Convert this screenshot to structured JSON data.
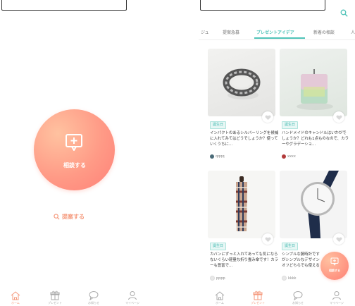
{
  "left": {
    "consult_button": {
      "label": "相談する",
      "icon": "chat-plus-icon"
    },
    "proposal_link": {
      "label": "提案する",
      "icon": "search-icon"
    }
  },
  "right": {
    "tabs": [
      "ジュ",
      "提案急募",
      "プレゼントアイデア",
      "新着の相談",
      "人"
    ],
    "active_tab_index": 2,
    "cards": [
      {
        "tag": "誕生日",
        "desc": "インパクトのあるシルバーリングを候補に入れてみてはどうでしょうか？使っていくうちに…",
        "user": "qqqq",
        "image": "silver-ring"
      },
      {
        "tag": "誕生日",
        "desc": "ハンドメイドのキャンドルはいかがでしょうか？どれも1点ものなので、カラーやグラデーショ…",
        "user": "xxxx",
        "image": "candle"
      },
      {
        "tag": "誕生日",
        "desc": "カバンにずっと入れてあっても気にならないぐらい軽量な折り畳み傘です！カラーも豊富で…",
        "user": "pppp",
        "image": "umbrella"
      },
      {
        "tag": "誕生日",
        "desc": "シンプルな腕時計ですがシンプルなデザインオフどちらでも使えるのではないでしょうか？…",
        "user": "kkkk",
        "image": "watch"
      }
    ],
    "fab_label": "相談する"
  },
  "nav": {
    "items": [
      {
        "label": "ホーム",
        "icon": "home-icon"
      },
      {
        "label": "プレゼント",
        "icon": "gift-icon"
      },
      {
        "label": "お知らせ",
        "icon": "chat-bubble-icon"
      },
      {
        "label": "マイページ",
        "icon": "person-icon"
      }
    ]
  },
  "colors": {
    "accent": "#f59a7d",
    "teal": "#4fc3b8",
    "gradient_start": "#ffc2a0",
    "gradient_end": "#ff8178"
  }
}
